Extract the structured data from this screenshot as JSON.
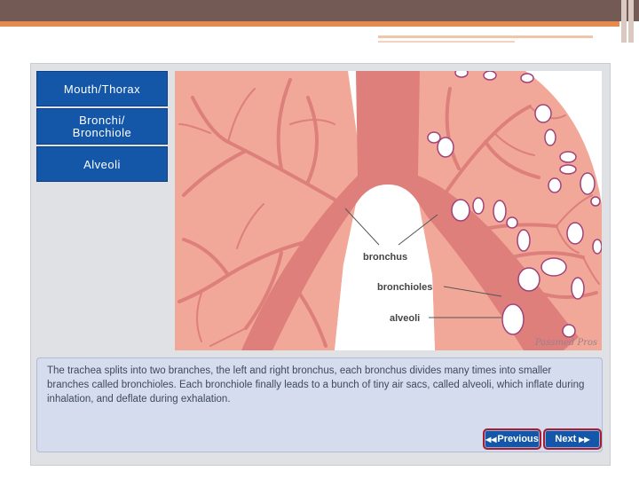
{
  "nav": {
    "items": [
      {
        "label": "Mouth/Thorax",
        "lines": [
          "Mouth/Thorax"
        ]
      },
      {
        "label": "Bronchi/ Bronchiole",
        "lines": [
          "Bronchi/",
          "Bronchiole"
        ]
      },
      {
        "label": "Alveoli",
        "lines": [
          "Alveoli"
        ]
      }
    ]
  },
  "diagram": {
    "labels": {
      "bronchus": "bronchus",
      "bronchioles": "bronchioles",
      "alveoli": "alveoli"
    },
    "watermark": "Passmed Pros"
  },
  "description": "The trachea splits into two branches, the left and right bronchus, each bronchus divides many times into smaller branches called bronchioles. Each bronchiole finally leads to a bunch of tiny air sacs, called alveoli, which inflate during inhalation, and deflate during exhalation.",
  "buttons": {
    "previous": "Previous",
    "next": "Next"
  },
  "colors": {
    "nav_blue": "#1457a8",
    "lung_pink": "#f2a898",
    "airway_red": "#de7f7c",
    "panel_blue": "#d4dcee"
  }
}
